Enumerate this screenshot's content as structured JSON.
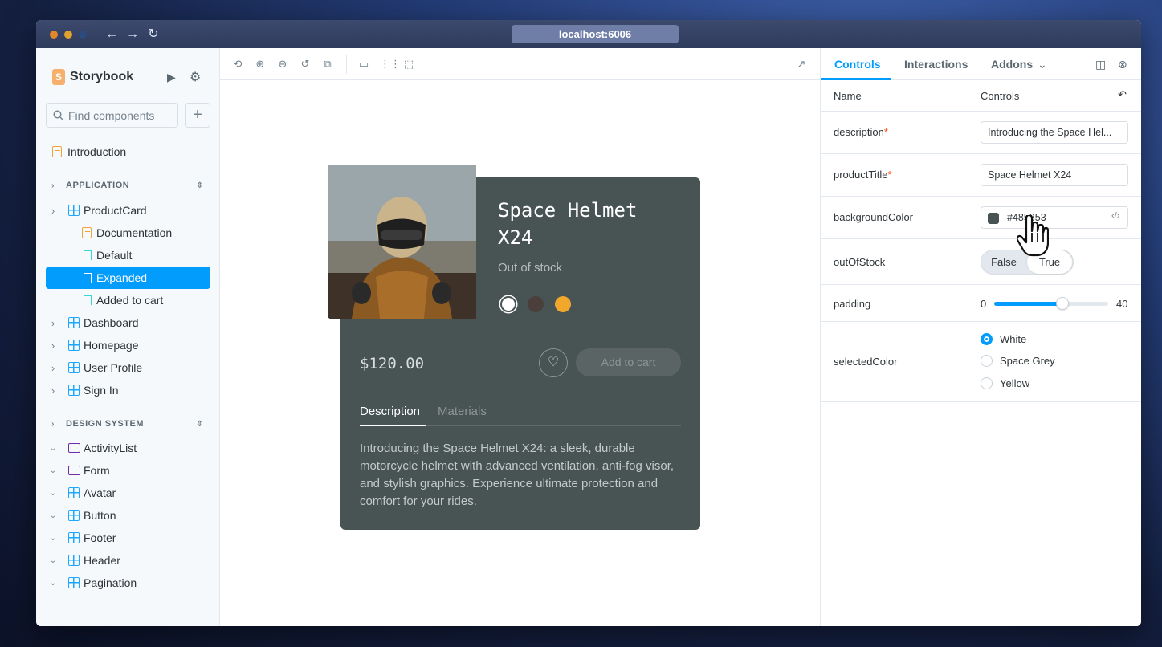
{
  "browser": {
    "url": "localhost:6006",
    "back": "←",
    "forward": "→",
    "reload": "↻"
  },
  "sidebar": {
    "brand": "Storybook",
    "search_placeholder": "Find components",
    "introduction": "Introduction",
    "group_application": "APPLICATION",
    "product_card": "ProductCard",
    "stories": [
      "Documentation",
      "Default",
      "Expanded",
      "Added to cart"
    ],
    "app_components": [
      "Dashboard",
      "Homepage",
      "User Profile",
      "Sign In"
    ],
    "group_design": "DESIGN SYSTEM",
    "design_folders": [
      "ActivityList",
      "Form"
    ],
    "design_components": [
      "Avatar",
      "Button",
      "Footer",
      "Header",
      "Pagination"
    ]
  },
  "card": {
    "title": "Space Helmet X24",
    "status": "Out of stock",
    "price": "$120.00",
    "add_to_cart": "Add to cart",
    "tabs": [
      "Description",
      "Materials"
    ],
    "description": "Introducing the Space Helmet X24: a sleek, durable motorcycle helmet with advanced ventilation, anti-fog visor, and stylish graphics. Experience ultimate protection and comfort for your rides.",
    "background": "#485353",
    "swatch_colors": [
      "#ffffff",
      "#4a3f3a",
      "#f0a72c"
    ]
  },
  "panel": {
    "tabs": [
      "Controls",
      "Interactions",
      "Addons"
    ],
    "header_name": "Name",
    "header_controls": "Controls",
    "rows": {
      "description": {
        "name": "description",
        "value": "Introducing the Space Hel..."
      },
      "productTitle": {
        "name": "productTitle",
        "value": "Space Helmet X24"
      },
      "backgroundColor": {
        "name": "backgroundColor",
        "value": "#485353"
      },
      "outOfStock": {
        "name": "outOfStock",
        "false_label": "False",
        "true_label": "True"
      },
      "padding": {
        "name": "padding",
        "min": "0",
        "max": "40",
        "fraction": 0.6
      },
      "selectedColor": {
        "name": "selectedColor",
        "options": [
          "White",
          "Space Grey",
          "Yellow"
        ]
      }
    },
    "required_mark": "*"
  },
  "colors": {
    "accent": "#029cfd",
    "brand": "#f6b06b"
  }
}
